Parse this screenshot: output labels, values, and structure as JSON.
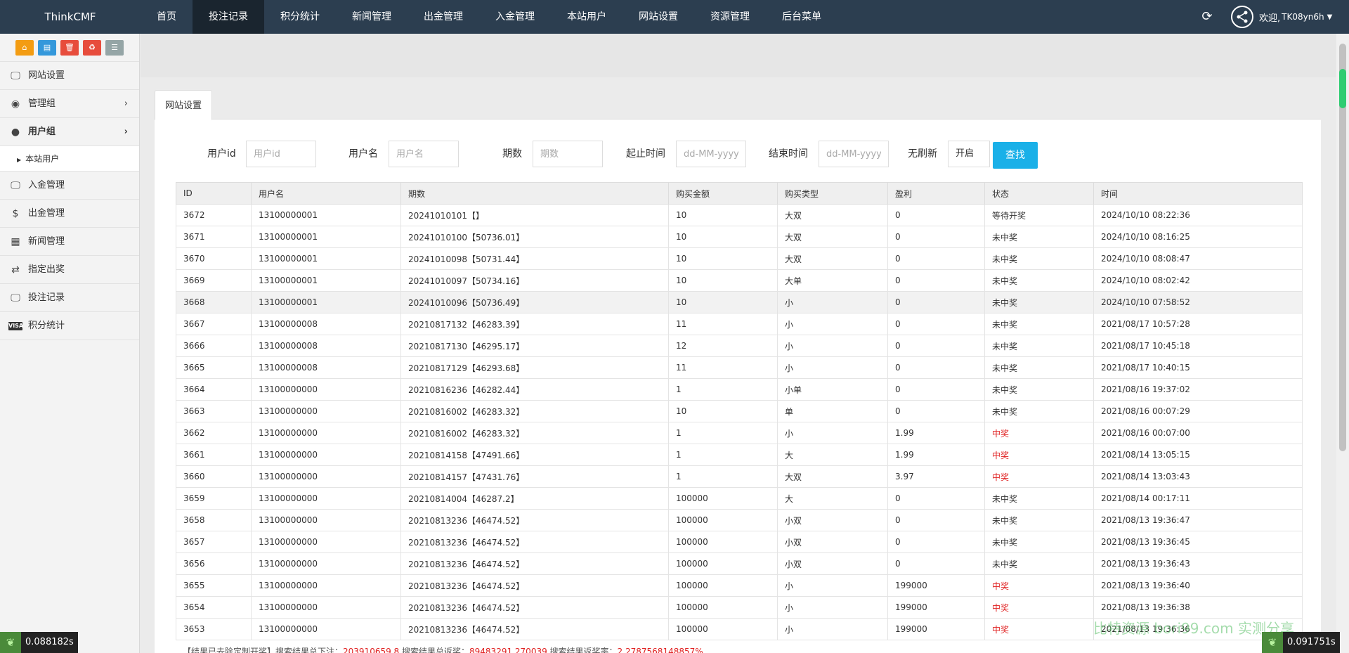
{
  "brand": "ThinkCMF",
  "nav": [
    "首页",
    "投注记录",
    "积分统计",
    "新闻管理",
    "出金管理",
    "入金管理",
    "本站用户",
    "网站设置",
    "资源管理",
    "后台菜单"
  ],
  "nav_active_index": 1,
  "user": {
    "welcome": "欢迎,",
    "name": "TK08yn6h"
  },
  "sidebar": {
    "items": [
      {
        "label": "网站设置",
        "icon": "monitor-icon"
      },
      {
        "label": "管理组",
        "icon": "user-circle-icon"
      },
      {
        "label": "用户组",
        "icon": "user-icon"
      },
      {
        "label": "本站用户",
        "icon": "triangle-right-icon"
      },
      {
        "label": "入金管理",
        "icon": "monitor-icon"
      },
      {
        "label": "出金管理",
        "icon": "dollar-icon"
      },
      {
        "label": "新闻管理",
        "icon": "newspaper-icon"
      },
      {
        "label": "指定出奖",
        "icon": "exchange-icon"
      },
      {
        "label": "投注记录",
        "icon": "monitor-icon"
      },
      {
        "label": "积分统计",
        "icon": "visa-icon"
      }
    ]
  },
  "tab": "网站设置",
  "filter": {
    "userid_label": "用户id",
    "userid_placeholder": "用户id",
    "username_label": "用户名",
    "username_placeholder": "用户名",
    "period_label": "期数",
    "period_placeholder": "期数",
    "start_label": "起止时间",
    "start_placeholder": "dd-MM-yyyy",
    "end_label": "结束时间",
    "end_placeholder": "dd-MM-yyyy",
    "refresh_label": "无刷新",
    "refresh_value": "开启",
    "search_button": "查找"
  },
  "table": {
    "headers": [
      "ID",
      "用户名",
      "期数",
      "购买金额",
      "购买类型",
      "盈利",
      "状态",
      "时间"
    ],
    "rows": [
      [
        "3672",
        "13100000001",
        "20241010101【】",
        "10",
        "大双",
        "0",
        "等待开奖",
        "2024/10/10 08:22:36"
      ],
      [
        "3671",
        "13100000001",
        "20241010100【50736.01】",
        "10",
        "大双",
        "0",
        "未中奖",
        "2024/10/10 08:16:25"
      ],
      [
        "3670",
        "13100000001",
        "20241010098【50731.44】",
        "10",
        "大双",
        "0",
        "未中奖",
        "2024/10/10 08:08:47"
      ],
      [
        "3669",
        "13100000001",
        "20241010097【50734.16】",
        "10",
        "大单",
        "0",
        "未中奖",
        "2024/10/10 08:02:42"
      ],
      [
        "3668",
        "13100000001",
        "20241010096【50736.49】",
        "10",
        "小",
        "0",
        "未中奖",
        "2024/10/10 07:58:52"
      ],
      [
        "3667",
        "13100000008",
        "20210817132【46283.39】",
        "11",
        "小",
        "0",
        "未中奖",
        "2021/08/17 10:57:28"
      ],
      [
        "3666",
        "13100000008",
        "20210817130【46295.17】",
        "12",
        "小",
        "0",
        "未中奖",
        "2021/08/17 10:45:18"
      ],
      [
        "3665",
        "13100000008",
        "20210817129【46293.68】",
        "11",
        "小",
        "0",
        "未中奖",
        "2021/08/17 10:40:15"
      ],
      [
        "3664",
        "13100000000",
        "20210816236【46282.44】",
        "1",
        "小单",
        "0",
        "未中奖",
        "2021/08/16 19:37:02"
      ],
      [
        "3663",
        "13100000000",
        "20210816002【46283.32】",
        "10",
        "单",
        "0",
        "未中奖",
        "2021/08/16 00:07:29"
      ],
      [
        "3662",
        "13100000000",
        "20210816002【46283.32】",
        "1",
        "小",
        "1.99",
        "中奖",
        "2021/08/16 00:07:00"
      ],
      [
        "3661",
        "13100000000",
        "20210814158【47491.66】",
        "1",
        "大",
        "1.99",
        "中奖",
        "2021/08/14 13:05:15"
      ],
      [
        "3660",
        "13100000000",
        "20210814157【47431.76】",
        "1",
        "大双",
        "3.97",
        "中奖",
        "2021/08/14 13:03:43"
      ],
      [
        "3659",
        "13100000000",
        "20210814004【46287.2】",
        "100000",
        "大",
        "0",
        "未中奖",
        "2021/08/14 00:17:11"
      ],
      [
        "3658",
        "13100000000",
        "20210813236【46474.52】",
        "100000",
        "小双",
        "0",
        "未中奖",
        "2021/08/13 19:36:47"
      ],
      [
        "3657",
        "13100000000",
        "20210813236【46474.52】",
        "100000",
        "小双",
        "0",
        "未中奖",
        "2021/08/13 19:36:45"
      ],
      [
        "3656",
        "13100000000",
        "20210813236【46474.52】",
        "100000",
        "小双",
        "0",
        "未中奖",
        "2021/08/13 19:36:43"
      ],
      [
        "3655",
        "13100000000",
        "20210813236【46474.52】",
        "100000",
        "小",
        "199000",
        "中奖",
        "2021/08/13 19:36:40"
      ],
      [
        "3654",
        "13100000000",
        "20210813236【46474.52】",
        "100000",
        "小",
        "199000",
        "中奖",
        "2021/08/13 19:36:38"
      ],
      [
        "3653",
        "13100000000",
        "20210813236【46474.52】",
        "100000",
        "小",
        "199000",
        "中奖",
        "2021/08/13 19:36:36"
      ]
    ]
  },
  "summary": {
    "prefix": "【结果已去除定制开奖】搜索结果总下注：",
    "total_bet": "203910659.8",
    "mid1": " 搜索结果总返奖：",
    "total_return": "89483291.270039",
    "mid2": " 搜索结果返奖率：",
    "rate": "2.2787568148857%"
  },
  "timer_left": "0.088182s",
  "timer_right": "0.091751s",
  "watermark": "比特资源 bori99.com 实测分享",
  "colors": {
    "topbar": "#2c3e50",
    "search_button": "#1ab0e8",
    "win_text": "#e02020"
  }
}
